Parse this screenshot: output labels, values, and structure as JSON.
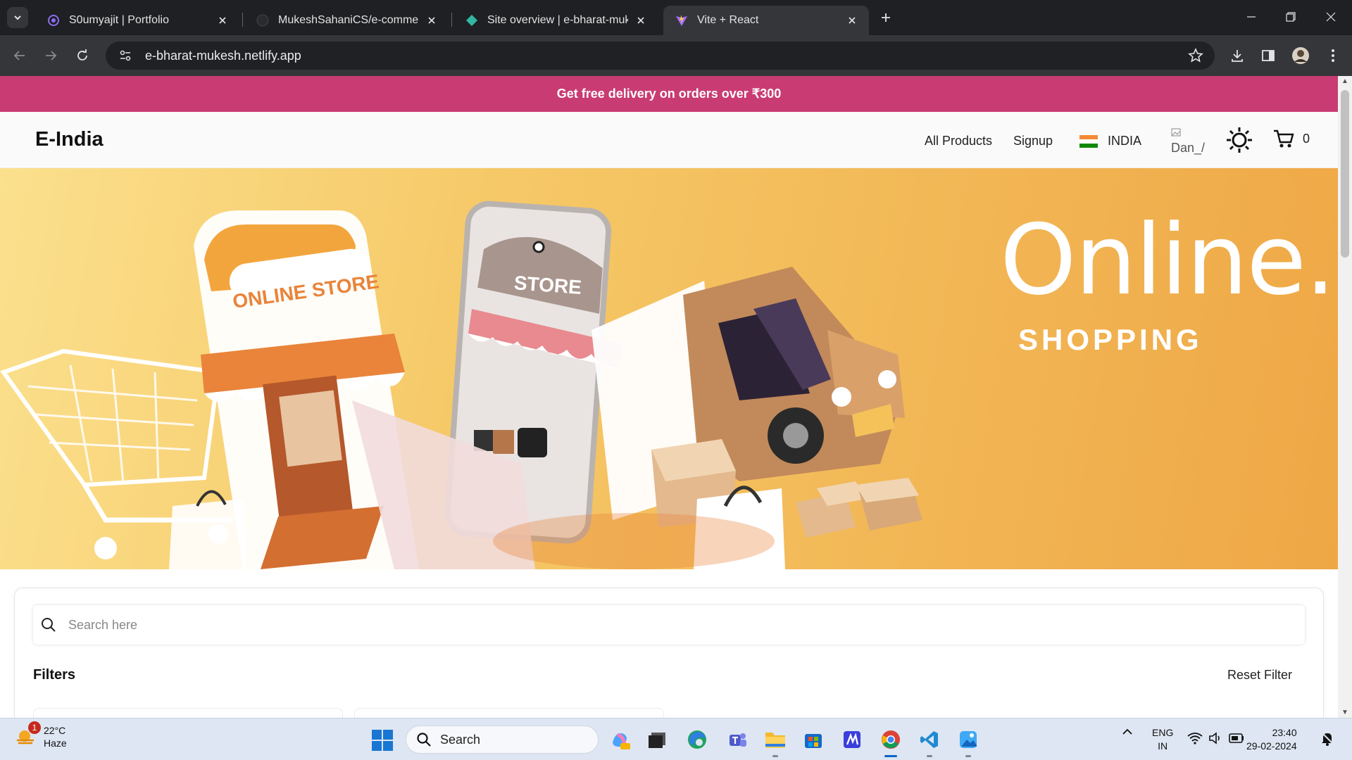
{
  "browser": {
    "tabs": [
      {
        "title": "S0umyajit | Portfolio",
        "active": false
      },
      {
        "title": "MukeshSahaniCS/e-commerce",
        "active": false
      },
      {
        "title": "Site overview | e-bharat-mukesh",
        "active": false
      },
      {
        "title": "Vite + React",
        "active": true
      }
    ],
    "url": "e-bharat-mukesh.netlify.app"
  },
  "page": {
    "promo_text": "Get free delivery on orders over ₹300",
    "brand": "E-India",
    "nav": {
      "all_products": "All Products",
      "signup": "Signup",
      "country": "INDIA",
      "avatar_alt": "Dan_/",
      "cart_count": "0"
    },
    "hero": {
      "title": "Online.",
      "subtitle": "SHOPPING",
      "store_sign": "ONLINE STORE",
      "phone_sign": "STORE"
    },
    "search": {
      "placeholder": "Search here"
    },
    "filters": {
      "title": "Filters",
      "reset_label": "Reset Filter"
    }
  },
  "taskbar": {
    "weather": {
      "temp": "22°C",
      "condition": "Haze",
      "badge": "1"
    },
    "search_label": "Search",
    "language": {
      "line1": "ENG",
      "line2": "IN"
    },
    "time": "23:40",
    "date": "29-02-2024"
  },
  "colors": {
    "promo_bg": "#c93c73",
    "hero_bg": "#f4bf5f",
    "browser_bg": "#35363a"
  }
}
